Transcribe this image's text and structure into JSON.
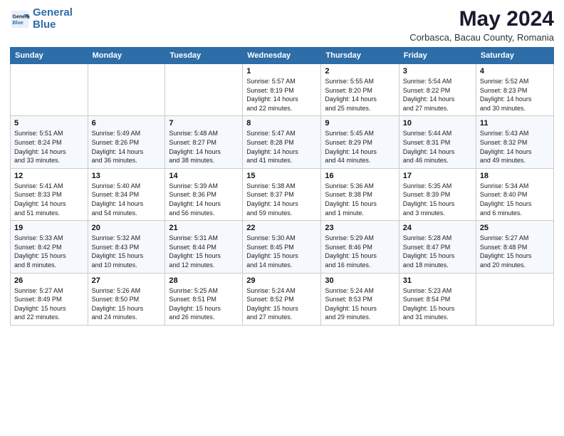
{
  "logo": {
    "line1": "General",
    "line2": "Blue"
  },
  "title": "May 2024",
  "location": "Corbasca, Bacau County, Romania",
  "weekdays": [
    "Sunday",
    "Monday",
    "Tuesday",
    "Wednesday",
    "Thursday",
    "Friday",
    "Saturday"
  ],
  "weeks": [
    [
      {
        "day": "",
        "info": ""
      },
      {
        "day": "",
        "info": ""
      },
      {
        "day": "",
        "info": ""
      },
      {
        "day": "1",
        "info": "Sunrise: 5:57 AM\nSunset: 8:19 PM\nDaylight: 14 hours\nand 22 minutes."
      },
      {
        "day": "2",
        "info": "Sunrise: 5:55 AM\nSunset: 8:20 PM\nDaylight: 14 hours\nand 25 minutes."
      },
      {
        "day": "3",
        "info": "Sunrise: 5:54 AM\nSunset: 8:22 PM\nDaylight: 14 hours\nand 27 minutes."
      },
      {
        "day": "4",
        "info": "Sunrise: 5:52 AM\nSunset: 8:23 PM\nDaylight: 14 hours\nand 30 minutes."
      }
    ],
    [
      {
        "day": "5",
        "info": "Sunrise: 5:51 AM\nSunset: 8:24 PM\nDaylight: 14 hours\nand 33 minutes."
      },
      {
        "day": "6",
        "info": "Sunrise: 5:49 AM\nSunset: 8:26 PM\nDaylight: 14 hours\nand 36 minutes."
      },
      {
        "day": "7",
        "info": "Sunrise: 5:48 AM\nSunset: 8:27 PM\nDaylight: 14 hours\nand 38 minutes."
      },
      {
        "day": "8",
        "info": "Sunrise: 5:47 AM\nSunset: 8:28 PM\nDaylight: 14 hours\nand 41 minutes."
      },
      {
        "day": "9",
        "info": "Sunrise: 5:45 AM\nSunset: 8:29 PM\nDaylight: 14 hours\nand 44 minutes."
      },
      {
        "day": "10",
        "info": "Sunrise: 5:44 AM\nSunset: 8:31 PM\nDaylight: 14 hours\nand 46 minutes."
      },
      {
        "day": "11",
        "info": "Sunrise: 5:43 AM\nSunset: 8:32 PM\nDaylight: 14 hours\nand 49 minutes."
      }
    ],
    [
      {
        "day": "12",
        "info": "Sunrise: 5:41 AM\nSunset: 8:33 PM\nDaylight: 14 hours\nand 51 minutes."
      },
      {
        "day": "13",
        "info": "Sunrise: 5:40 AM\nSunset: 8:34 PM\nDaylight: 14 hours\nand 54 minutes."
      },
      {
        "day": "14",
        "info": "Sunrise: 5:39 AM\nSunset: 8:36 PM\nDaylight: 14 hours\nand 56 minutes."
      },
      {
        "day": "15",
        "info": "Sunrise: 5:38 AM\nSunset: 8:37 PM\nDaylight: 14 hours\nand 59 minutes."
      },
      {
        "day": "16",
        "info": "Sunrise: 5:36 AM\nSunset: 8:38 PM\nDaylight: 15 hours\nand 1 minute."
      },
      {
        "day": "17",
        "info": "Sunrise: 5:35 AM\nSunset: 8:39 PM\nDaylight: 15 hours\nand 3 minutes."
      },
      {
        "day": "18",
        "info": "Sunrise: 5:34 AM\nSunset: 8:40 PM\nDaylight: 15 hours\nand 6 minutes."
      }
    ],
    [
      {
        "day": "19",
        "info": "Sunrise: 5:33 AM\nSunset: 8:42 PM\nDaylight: 15 hours\nand 8 minutes."
      },
      {
        "day": "20",
        "info": "Sunrise: 5:32 AM\nSunset: 8:43 PM\nDaylight: 15 hours\nand 10 minutes."
      },
      {
        "day": "21",
        "info": "Sunrise: 5:31 AM\nSunset: 8:44 PM\nDaylight: 15 hours\nand 12 minutes."
      },
      {
        "day": "22",
        "info": "Sunrise: 5:30 AM\nSunset: 8:45 PM\nDaylight: 15 hours\nand 14 minutes."
      },
      {
        "day": "23",
        "info": "Sunrise: 5:29 AM\nSunset: 8:46 PM\nDaylight: 15 hours\nand 16 minutes."
      },
      {
        "day": "24",
        "info": "Sunrise: 5:28 AM\nSunset: 8:47 PM\nDaylight: 15 hours\nand 18 minutes."
      },
      {
        "day": "25",
        "info": "Sunrise: 5:27 AM\nSunset: 8:48 PM\nDaylight: 15 hours\nand 20 minutes."
      }
    ],
    [
      {
        "day": "26",
        "info": "Sunrise: 5:27 AM\nSunset: 8:49 PM\nDaylight: 15 hours\nand 22 minutes."
      },
      {
        "day": "27",
        "info": "Sunrise: 5:26 AM\nSunset: 8:50 PM\nDaylight: 15 hours\nand 24 minutes."
      },
      {
        "day": "28",
        "info": "Sunrise: 5:25 AM\nSunset: 8:51 PM\nDaylight: 15 hours\nand 26 minutes."
      },
      {
        "day": "29",
        "info": "Sunrise: 5:24 AM\nSunset: 8:52 PM\nDaylight: 15 hours\nand 27 minutes."
      },
      {
        "day": "30",
        "info": "Sunrise: 5:24 AM\nSunset: 8:53 PM\nDaylight: 15 hours\nand 29 minutes."
      },
      {
        "day": "31",
        "info": "Sunrise: 5:23 AM\nSunset: 8:54 PM\nDaylight: 15 hours\nand 31 minutes."
      },
      {
        "day": "",
        "info": ""
      }
    ]
  ]
}
